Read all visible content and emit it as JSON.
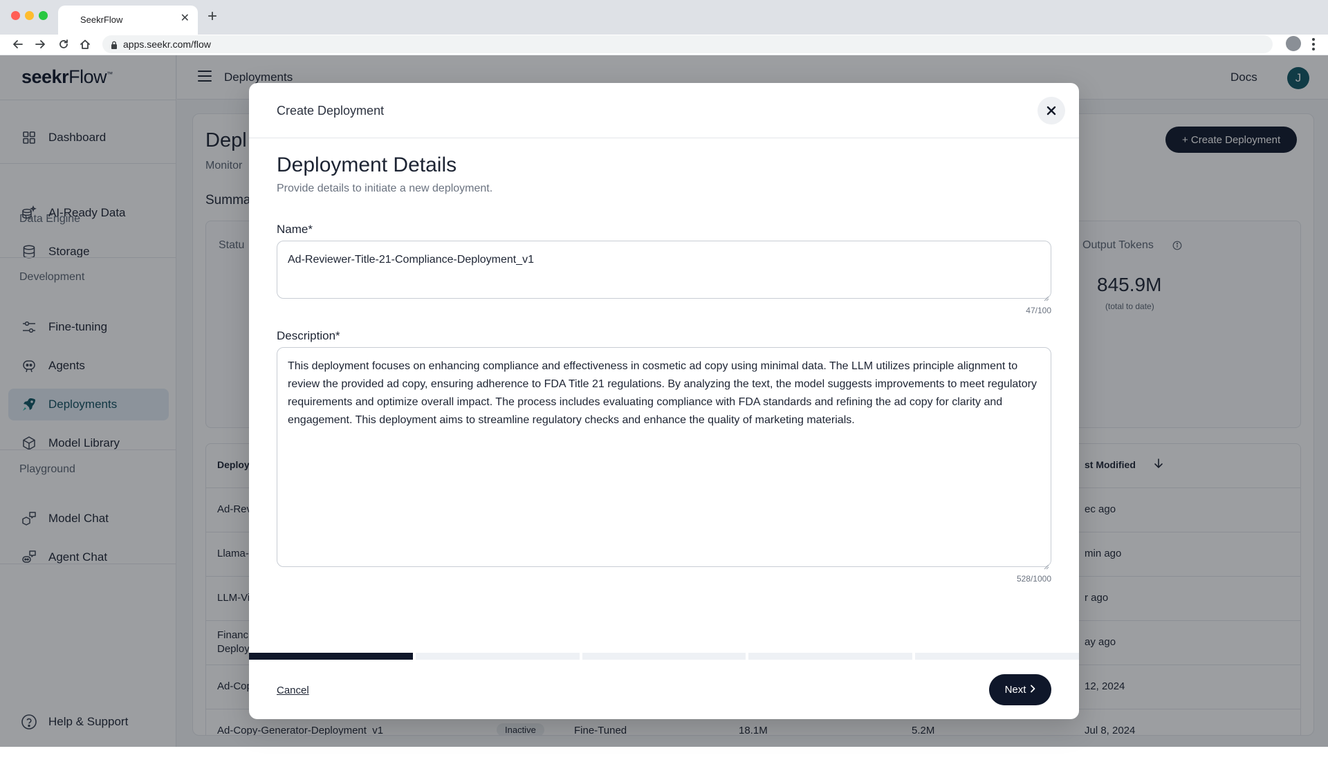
{
  "browser": {
    "tab_title": "SeekrFlow",
    "url": "apps.seekr.com/flow"
  },
  "app": {
    "logo_bold": "seekr",
    "logo_thin": "Flow",
    "logo_mark": "™"
  },
  "sidebar": {
    "dashboard": "Dashboard",
    "group_data": "Data Engine",
    "ai_ready": "AI-Ready Data",
    "storage": "Storage",
    "group_dev": "Development",
    "finetuning": "Fine-tuning",
    "agents": "Agents",
    "deployments": "Deployments",
    "model_library": "Model Library",
    "group_play": "Playground",
    "model_chat": "Model Chat",
    "agent_chat": "Agent Chat",
    "help": "Help & Support"
  },
  "topbar": {
    "breadcrumb": "Deployments",
    "docs": "Docs",
    "avatar_initial": "J"
  },
  "page": {
    "title_fragment": "Depl",
    "subtitle_fragment": "Monitor",
    "summary_fragment": "Summa",
    "create_button": "+ Create Deployment",
    "status_fragment": "Statu",
    "output_tokens_label": "Output Tokens",
    "output_tokens_value": "845.9M",
    "output_tokens_note": "(total to date)"
  },
  "table": {
    "head_left": "Deploy",
    "head_right": "st Modified",
    "rows": [
      {
        "left": "Ad-Rev",
        "right": "ec ago"
      },
      {
        "left": "Llama-",
        "right": "min ago"
      },
      {
        "left": "LLM-Vi",
        "right": "r ago"
      },
      {
        "left": "Financ",
        "left2": "Deploy",
        "right": "ay ago"
      },
      {
        "left": "Ad-Cop",
        "right": "12, 2024"
      },
      {
        "left": "Ad-Copy-Generator-Deployment_v1",
        "status": "Inactive",
        "type": "Fine-Tuned",
        "c3": "18.1M",
        "c4": "5.2M",
        "right": "Jul 8, 2024"
      }
    ]
  },
  "modal": {
    "title": "Create Deployment",
    "heading": "Deployment Details",
    "subheading": "Provide details to initiate a new deployment.",
    "name_label": "Name*",
    "name_value": "Ad-Reviewer-Title-21-Compliance-Deployment_v1",
    "name_counter": "47/100",
    "description_label": "Description*",
    "description_value": "This deployment focuses on enhancing compliance and effectiveness in cosmetic ad copy using minimal data. The LLM utilizes principle alignment to review the provided ad copy, ensuring adherence to FDA Title 21 regulations. By analyzing the text, the model suggests improvements to meet regulatory requirements and optimize overall impact. The process includes evaluating compliance with FDA standards and refining the ad copy for clarity and engagement. This deployment aims to streamline regulatory checks and enhance the quality of marketing materials.",
    "description_counter": "528/1000",
    "cancel": "Cancel",
    "next": "Next",
    "steps_total": 5,
    "steps_completed": 1
  },
  "colors": {
    "primary_dark": "#0f172a",
    "accent_teal": "#0f5562",
    "active_nav_bg": "#e3ecf5"
  }
}
